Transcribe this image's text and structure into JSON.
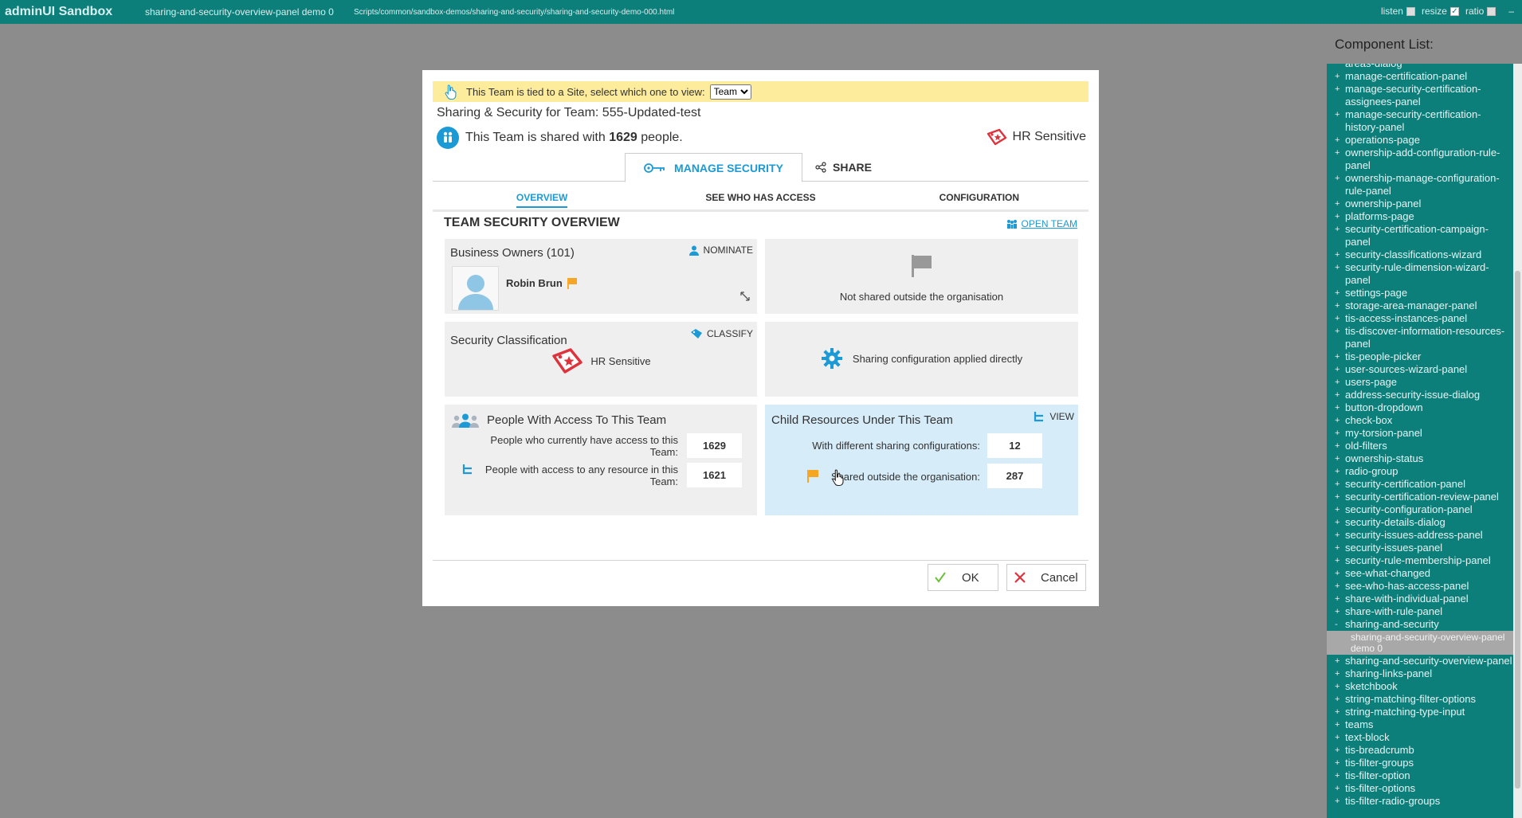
{
  "topbar": {
    "app_title": "adminUI Sandbox",
    "demo_name": "sharing-and-security-overview-panel demo 0",
    "script_path": "Scripts/common/sandbox-demos/sharing-and-security/sharing-and-security-demo-000.html",
    "listen_label": "listen",
    "resize_label": "resize",
    "ratio_label": "ratio",
    "minimize_label": "–",
    "resize_checked": true,
    "listen_checked": false,
    "ratio_checked": false
  },
  "component_list": {
    "title": "Component List:",
    "items": [
      {
        "label": "areas-dialog",
        "prefix": ""
      },
      {
        "label": "manage-certification-panel",
        "prefix": "+"
      },
      {
        "label": "manage-security-certification-assignees-panel",
        "prefix": "+"
      },
      {
        "label": "manage-security-certification-history-panel",
        "prefix": "+"
      },
      {
        "label": "operations-page",
        "prefix": "+"
      },
      {
        "label": "ownership-add-configuration-rule-panel",
        "prefix": "+"
      },
      {
        "label": "ownership-manage-configuration-rule-panel",
        "prefix": "+"
      },
      {
        "label": "ownership-panel",
        "prefix": "+"
      },
      {
        "label": "platforms-page",
        "prefix": "+"
      },
      {
        "label": "security-certification-campaign-panel",
        "prefix": "+"
      },
      {
        "label": "security-classifications-wizard",
        "prefix": "+"
      },
      {
        "label": "security-rule-dimension-wizard-panel",
        "prefix": "+"
      },
      {
        "label": "settings-page",
        "prefix": "+"
      },
      {
        "label": "storage-area-manager-panel",
        "prefix": "+"
      },
      {
        "label": "tis-access-instances-panel",
        "prefix": "+"
      },
      {
        "label": "tis-discover-information-resources-panel",
        "prefix": "+"
      },
      {
        "label": "tis-people-picker",
        "prefix": "+"
      },
      {
        "label": "user-sources-wizard-panel",
        "prefix": "+"
      },
      {
        "label": "users-page",
        "prefix": "+"
      },
      {
        "label": "address-security-issue-dialog",
        "prefix": "+"
      },
      {
        "label": "button-dropdown",
        "prefix": "+"
      },
      {
        "label": "check-box",
        "prefix": "+"
      },
      {
        "label": "my-torsion-panel",
        "prefix": "+"
      },
      {
        "label": "old-filters",
        "prefix": "+"
      },
      {
        "label": "ownership-status",
        "prefix": "+"
      },
      {
        "label": "radio-group",
        "prefix": "+"
      },
      {
        "label": "security-certification-panel",
        "prefix": "+"
      },
      {
        "label": "security-certification-review-panel",
        "prefix": "+"
      },
      {
        "label": "security-configuration-panel",
        "prefix": "+"
      },
      {
        "label": "security-details-dialog",
        "prefix": "+"
      },
      {
        "label": "security-issues-address-panel",
        "prefix": "+"
      },
      {
        "label": "security-issues-panel",
        "prefix": "+"
      },
      {
        "label": "security-rule-membership-panel",
        "prefix": "+"
      },
      {
        "label": "see-what-changed",
        "prefix": "+"
      },
      {
        "label": "see-who-has-access-panel",
        "prefix": "+"
      },
      {
        "label": "share-with-individual-panel",
        "prefix": "+"
      },
      {
        "label": "share-with-rule-panel",
        "prefix": "+"
      },
      {
        "label": "sharing-and-security",
        "prefix": "-"
      },
      {
        "label": "sharing-and-security-overview-panel demo 0",
        "prefix": "",
        "selected": true
      },
      {
        "label": "sharing-and-security-overview-panel",
        "prefix": "+"
      },
      {
        "label": "sharing-links-panel",
        "prefix": "+"
      },
      {
        "label": "sketchbook",
        "prefix": "+"
      },
      {
        "label": "string-matching-filter-options",
        "prefix": "+"
      },
      {
        "label": "string-matching-type-input",
        "prefix": "+"
      },
      {
        "label": "teams",
        "prefix": "+"
      },
      {
        "label": "text-block",
        "prefix": "+"
      },
      {
        "label": "tis-breadcrumb",
        "prefix": "+"
      },
      {
        "label": "tis-filter-groups",
        "prefix": "+"
      },
      {
        "label": "tis-filter-option",
        "prefix": "+"
      },
      {
        "label": "tis-filter-options",
        "prefix": "+"
      },
      {
        "label": "tis-filter-radio-groups",
        "prefix": "+"
      }
    ]
  },
  "dialog": {
    "banner_text": "This Team is tied to a Site, select which one to view:",
    "banner_select_value": "Team",
    "title": "Sharing & Security for Team: 555-Updated-test",
    "shared_prefix": "This Team is shared with ",
    "shared_count": "1629",
    "shared_suffix": " people.",
    "classification": "HR Sensitive",
    "main_tabs": {
      "manage": "MANAGE SECURITY",
      "share": "SHARE"
    },
    "sub_tabs": {
      "overview": "OVERVIEW",
      "see_who": "SEE WHO HAS ACCESS",
      "configuration": "CONFIGURATION"
    },
    "overview_title": "TEAM SECURITY OVERVIEW",
    "open_team": "OPEN TEAM",
    "owners": {
      "title": "Business Owners (101)",
      "nominate": "NOMINATE",
      "owner_name": "Robin Brun"
    },
    "external_sharing": "Not shared outside the organisation",
    "classification_card": {
      "title": "Security Classification",
      "classify": "CLASSIFY",
      "value": "HR Sensitive"
    },
    "sharing_config": "Sharing configuration applied directly",
    "people_card": {
      "title": "People With Access To This Team",
      "row1_label": "People who currently have access to this Team:",
      "row1_value": "1629",
      "row2_label": "People with access to any resource in this Team:",
      "row2_value": "1621"
    },
    "child_card": {
      "title": "Child Resources Under This Team",
      "view": "VIEW",
      "row1_label": "With different sharing configurations:",
      "row1_value": "12",
      "row2_label": "Shared outside the organisation:",
      "row2_value": "287"
    },
    "ok_label": "OK",
    "cancel_label": "Cancel"
  },
  "colors": {
    "topbar": "#0d7f7a",
    "accent": "#1b9ad6",
    "banner": "#fcec9c",
    "flag": "#f5a623",
    "danger": "#e0323c",
    "child_card_bg": "#d6ecf8"
  }
}
